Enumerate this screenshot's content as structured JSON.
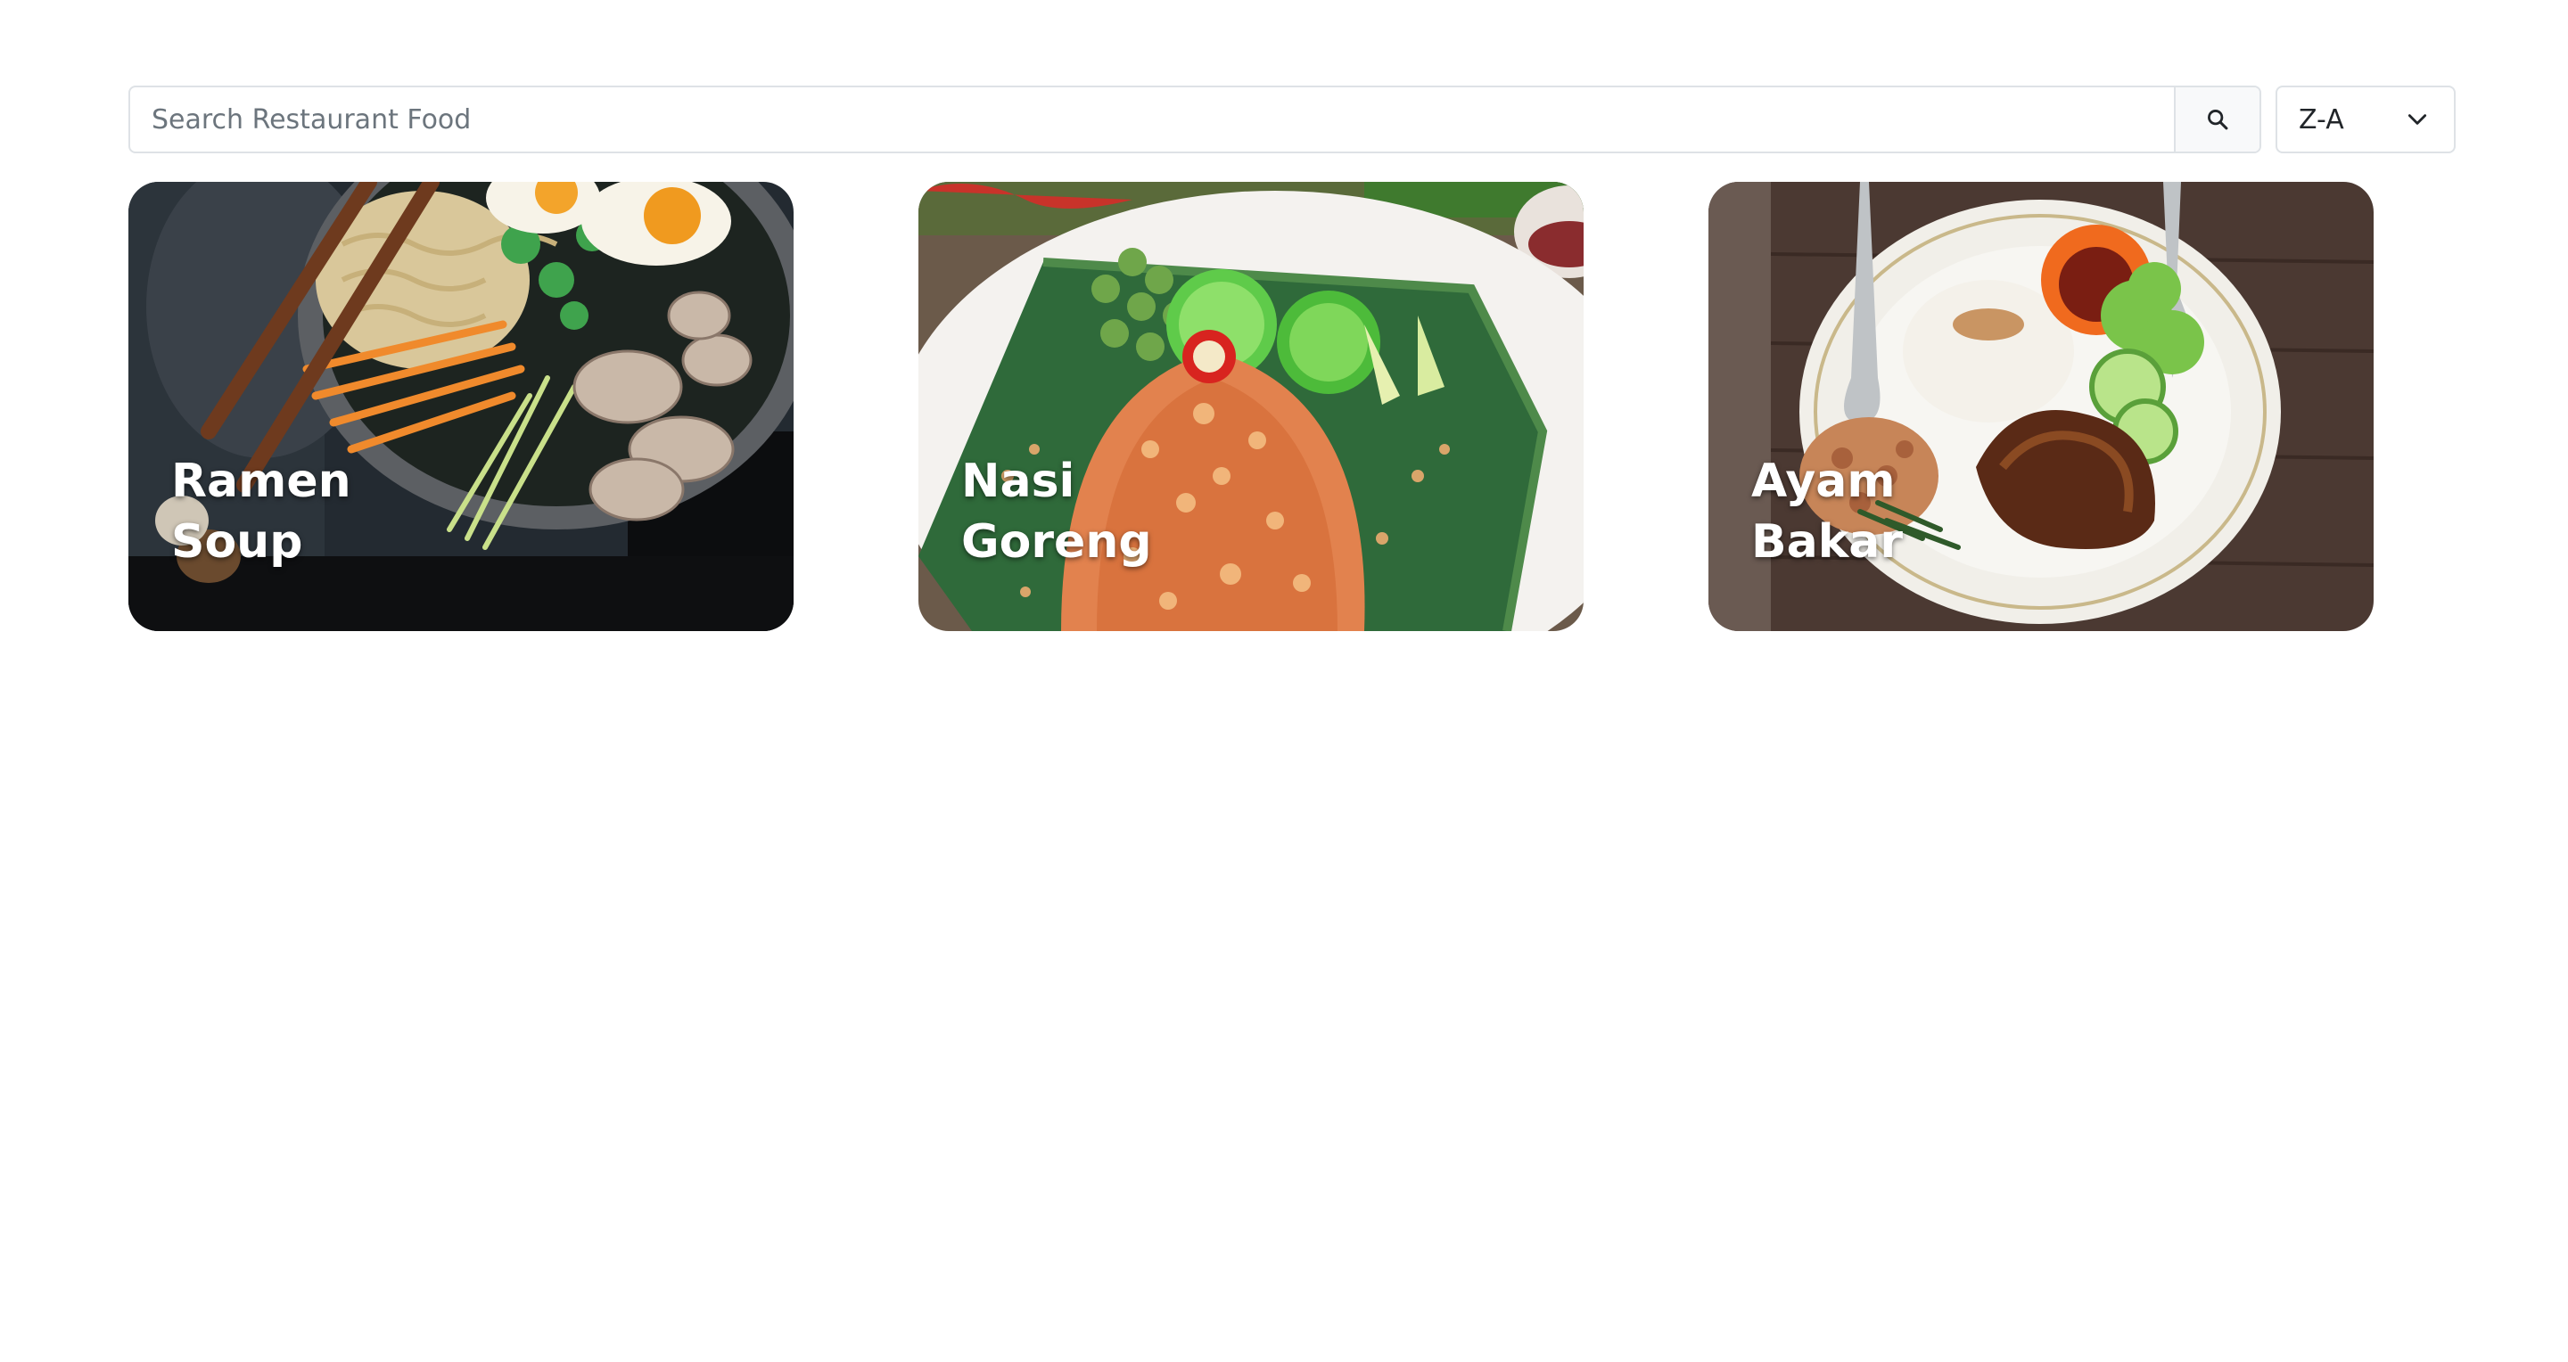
{
  "search": {
    "placeholder": "Search Restaurant Food",
    "value": "",
    "button_icon": "search-icon"
  },
  "sort": {
    "selected": "Z-A",
    "icon": "chevron-down-icon"
  },
  "cards": [
    {
      "title": "Ramen\nSoup",
      "image": "ramen-soup-photo"
    },
    {
      "title": "Nasi\nGoreng",
      "image": "nasi-goreng-photo"
    },
    {
      "title": "Ayam\nBakar",
      "image": "ayam-bakar-photo"
    }
  ],
  "colors": {
    "border": "#dee2e6",
    "button_bg": "#f8f9fa",
    "text": "#212529",
    "placeholder": "#6c757d",
    "card_title": "#ffffff"
  }
}
